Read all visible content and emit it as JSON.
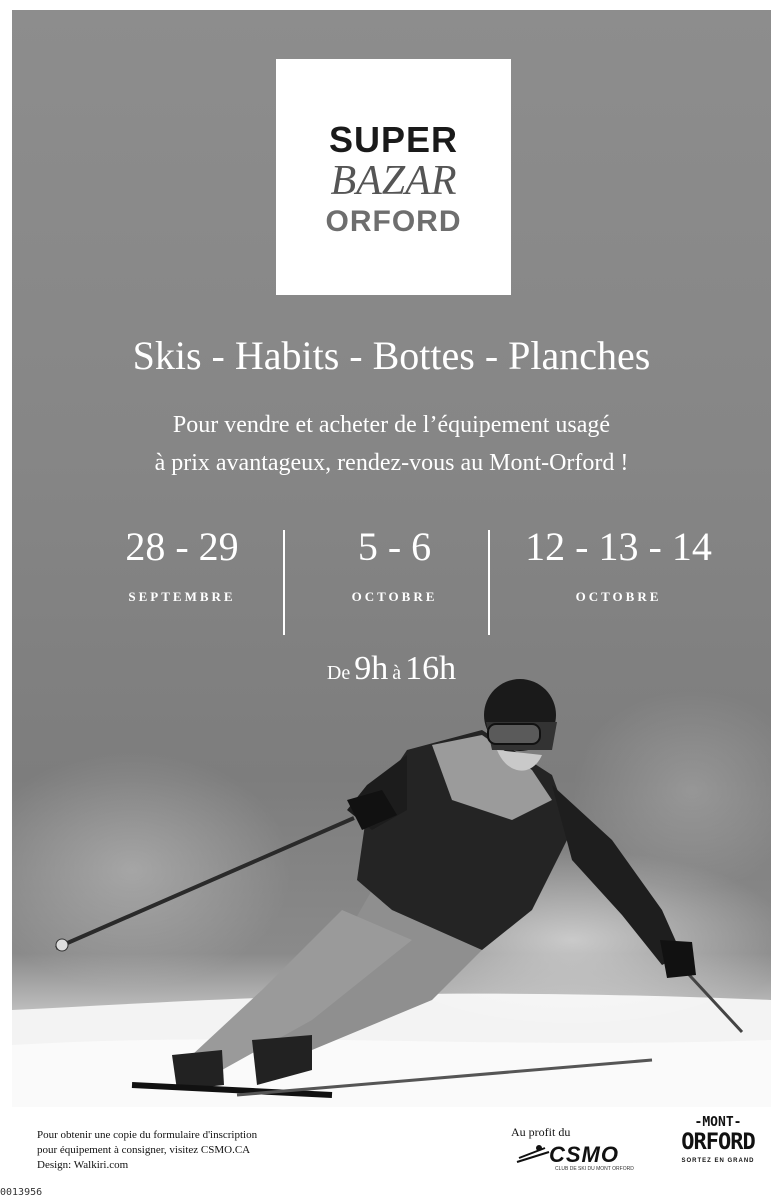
{
  "logo": {
    "line1": "SUPER",
    "line2": "BAZAR",
    "line3": "ORFORD"
  },
  "headline": "Skis - Habits - Bottes - Planches",
  "intro": {
    "line1": "Pour vendre et acheter de l’équipement usagé",
    "line2": "à prix avantageux, rendez-vous au Mont-Orford !"
  },
  "dates": [
    {
      "days": "28 - 29",
      "month": "SEPTEMBRE"
    },
    {
      "days": "5 - 6",
      "month": "OCTOBRE"
    },
    {
      "days": "12 - 13 - 14",
      "month": "OCTOBRE"
    }
  ],
  "hours": {
    "prefix": "De",
    "start": "9h",
    "mid": "à",
    "end": "16h"
  },
  "footer": {
    "line1": "Pour obtenir une copie du formulaire d'inscription",
    "line2": "pour équipement à consigner, visitez CSMO.CA",
    "line3": "Design: Walkiri.com",
    "profit_label": "Au profit du",
    "csmo_name": "CSMO",
    "csmo_sub": "CLUB DE SKI DU MONT ORFORD",
    "mont_top": "-MONT-",
    "mont_name": "ORFORD",
    "mont_tagline": "SORTEZ EN GRAND"
  },
  "code": "0013956",
  "colors": {
    "poster_bg": "#888888",
    "text_light": "#ffffff",
    "text_dark": "#111111"
  }
}
